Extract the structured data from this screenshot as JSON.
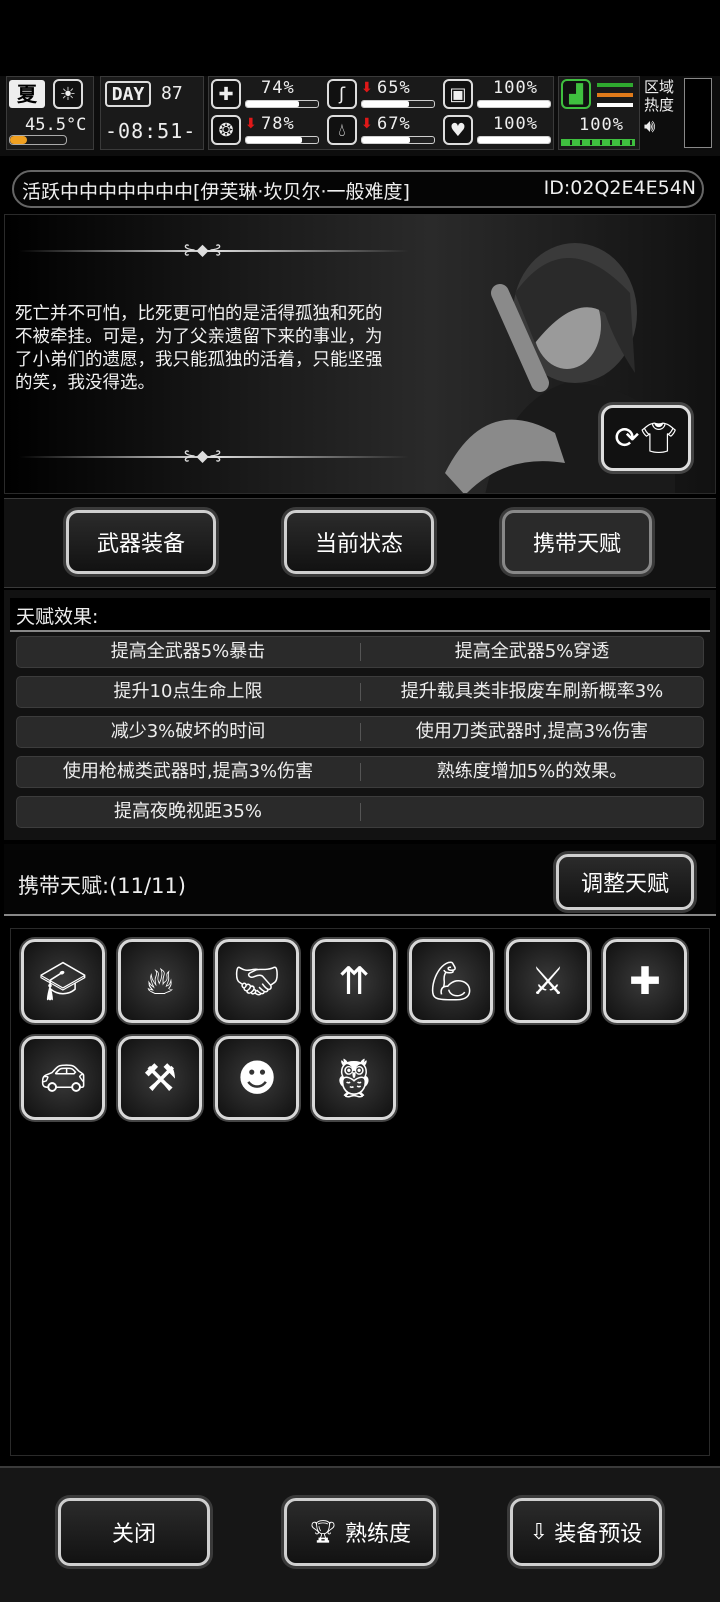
{
  "hud": {
    "season": "夏",
    "temperature": "45.5°C",
    "day_label": "DAY",
    "day_number": "87",
    "clock": "-08:51-",
    "stats": [
      {
        "icon": "medkit-icon",
        "value": "74%",
        "level": 0.74,
        "down": false
      },
      {
        "icon": "stomach-icon",
        "value": "65%",
        "level": 0.65,
        "down": true
      },
      {
        "icon": "armor-icon",
        "value": "100%",
        "level": 1.0,
        "down": false
      },
      {
        "icon": "brain-icon",
        "value": "78%",
        "level": 0.78,
        "down": true
      },
      {
        "icon": "water-drop-icon",
        "value": "67%",
        "level": 0.67,
        "down": true
      },
      {
        "icon": "heart-icon",
        "value": "100%",
        "level": 1.0,
        "down": false
      }
    ],
    "stamina": "100%",
    "zone_heat_label": "区域热度"
  },
  "title": {
    "text": "活跃中中中中中中中[伊芙琳·坎贝尔·一般难度]",
    "id": "ID:02Q2E4E54N"
  },
  "bio": {
    "quote": "死亡并不可怕，比死更可怕的是活得孤独和死的不被牵挂。可是，为了父亲遗留下来的事业，为了小弟们的遗愿，我只能孤独的活着，只能坚强的笑，我没得选。"
  },
  "tabs": {
    "weapons": "武器装备",
    "status": "当前状态",
    "talents": "携带天赋"
  },
  "effects": {
    "header": "天赋效果:",
    "rows": [
      [
        "提高全武器5%暴击",
        "提高全武器5%穿透"
      ],
      [
        "提升10点生命上限",
        "提升载具类非报废车刷新概率3%"
      ],
      [
        "减少3%破坏的时间",
        "使用刀类武器时,提高3%伤害"
      ],
      [
        "使用枪械类武器时,提高3%伤害",
        "熟练度增加5%的效果。"
      ],
      [
        "提高夜晚视距35%",
        ""
      ]
    ]
  },
  "carry": {
    "label": "携带天赋:(11/11)",
    "adjust": "调整天赋"
  },
  "talents": [
    "graduation-cap-icon",
    "fire-door-icon",
    "handshake-icon",
    "speed-run-icon",
    "muscle-arm-icon",
    "crossed-swords-icon",
    "medkit-plus-icon",
    "sports-car-icon",
    "crossed-axes-icon",
    "brain-head-icon",
    "owl-icon"
  ],
  "bottom": {
    "close": "关闭",
    "proficiency": "熟练度",
    "preset": "装备预设"
  }
}
